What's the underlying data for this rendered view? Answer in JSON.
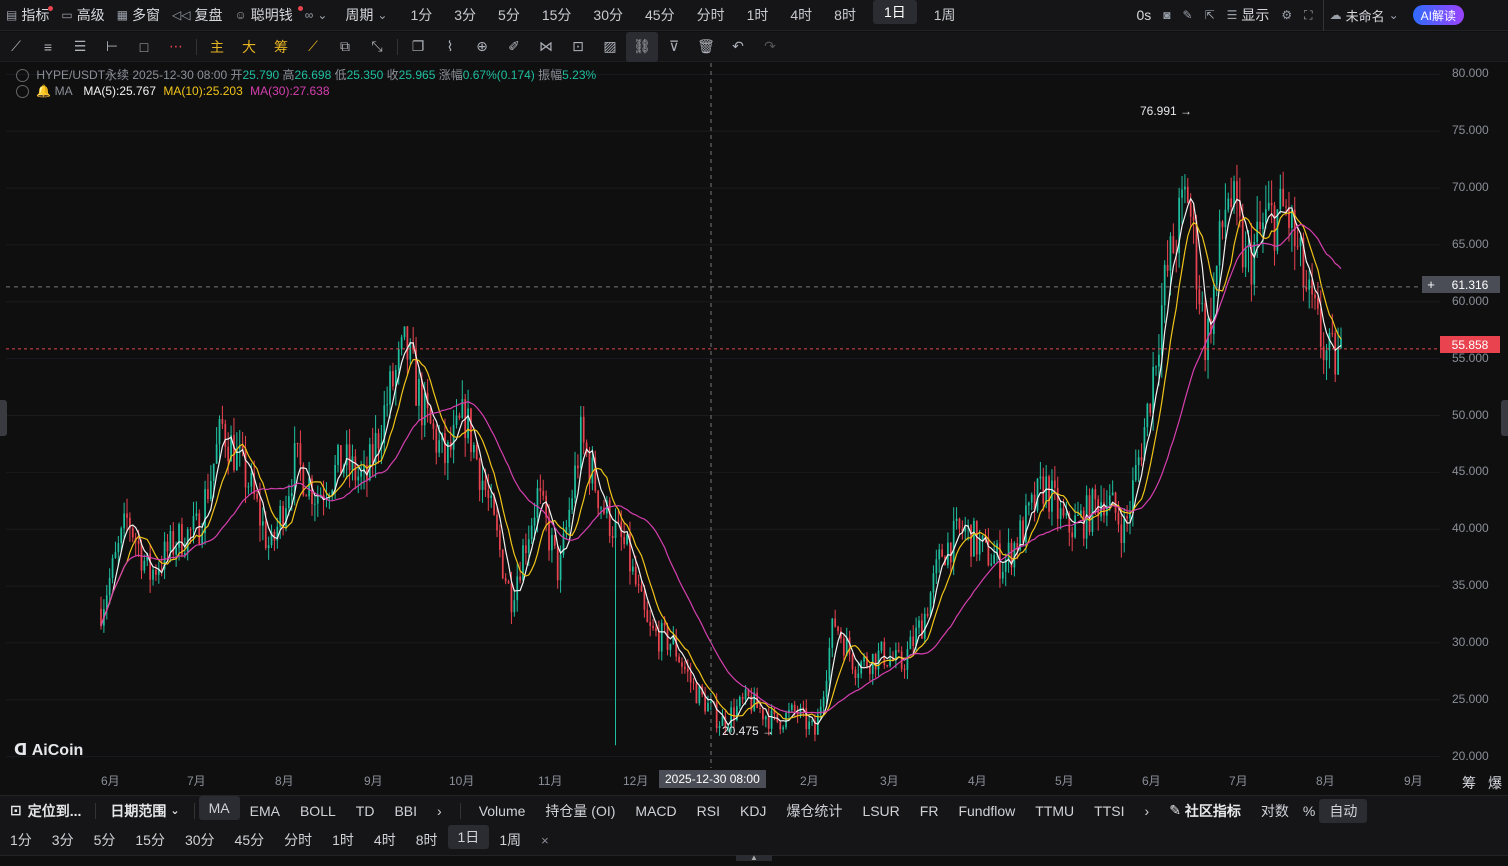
{
  "topbar": {
    "items": [
      {
        "label": "指标",
        "icon": "indicator-icon"
      },
      {
        "label": "高级",
        "icon": "layout-icon"
      },
      {
        "label": "多窗",
        "icon": "grid-icon"
      },
      {
        "label": "复盘",
        "icon": "rewind-icon"
      },
      {
        "label": "聪明钱",
        "icon": "smart-money-icon"
      }
    ],
    "period_label": "周期",
    "timeframes": [
      "1分",
      "3分",
      "5分",
      "15分",
      "30分",
      "45分",
      "分时",
      "1时",
      "4时",
      "8时",
      "1日",
      "1周"
    ],
    "active_timeframe": "1日",
    "countdown": "0s",
    "display_label": "显示",
    "unnamed_label": "未命名",
    "ai_label": "AI解读"
  },
  "legend": {
    "symbol": "HYPE/USDT永续",
    "datetime": "2025-12-30 08:00",
    "open_label": "开",
    "open": "25.790",
    "high_label": "高",
    "high": "26.698",
    "low_label": "低",
    "low": "25.350",
    "close_label": "收",
    "close": "25.965",
    "change_label": "涨幅",
    "change": "0.67%(0.174)",
    "amp_label": "振幅",
    "amp": "5.23%",
    "ma_title": "MA",
    "ma5": "MA(5):25.767",
    "ma10": "MA(10):25.203",
    "ma30": "MA(30):27.638"
  },
  "colors": {
    "up": "#1fbf9f",
    "down": "#e8434f",
    "ma5": "#f2f2f2",
    "ma10": "#f0c419",
    "ma30": "#d63fae"
  },
  "price_axis": [
    "80.000",
    "75.000",
    "70.000",
    "65.000",
    "60.000",
    "55.000",
    "50.000",
    "45.000",
    "40.000",
    "35.000",
    "30.000",
    "25.000",
    "20.000"
  ],
  "crosshair_price": "61.316",
  "current_price": "55.858",
  "high_marker": "76.991",
  "low_marker": "20.475",
  "crosshair_time": "2025-12-30 08:00",
  "watermark": "AiCoin",
  "time_axis": [
    "6月",
    "7月",
    "8月",
    "9月",
    "10月",
    "11月",
    "12月",
    "2月",
    "3月",
    "4月",
    "5月",
    "6月",
    "7月",
    "8月",
    "9月"
  ],
  "axis_corner": [
    "筹",
    "爆"
  ],
  "bottom_bar": {
    "locate": "定位到...",
    "date_range": "日期范围",
    "main_indicators": [
      "MA",
      "EMA",
      "BOLL",
      "TD",
      "BBI"
    ],
    "active_indicator": "MA",
    "sub_indicators": [
      "Volume",
      "持仓量 (OI)",
      "MACD",
      "RSI",
      "KDJ",
      "爆仓统计",
      "LSUR",
      "FR",
      "Fundflow",
      "TTMU",
      "TTSI"
    ],
    "community": "社区指标",
    "log_label": "对数",
    "pct_label": "%",
    "auto_label": "自动"
  },
  "quick_timeframes": [
    "1分",
    "3分",
    "5分",
    "15分",
    "30分",
    "45分",
    "分时",
    "1时",
    "4时",
    "8时",
    "1日",
    "1周"
  ],
  "quick_active": "1日",
  "chart_data": {
    "type": "candlestick",
    "symbol": "HYPE/USDT永续",
    "ylim": [
      19,
      81
    ],
    "x_count": 430,
    "close_path": [
      [
        0,
        33
      ],
      [
        10,
        41
      ],
      [
        18,
        36
      ],
      [
        28,
        39
      ],
      [
        36,
        40
      ],
      [
        45,
        49
      ],
      [
        55,
        44
      ],
      [
        63,
        38
      ],
      [
        72,
        46
      ],
      [
        80,
        43
      ],
      [
        90,
        46
      ],
      [
        98,
        44
      ],
      [
        107,
        52
      ],
      [
        113,
        56
      ],
      [
        120,
        50
      ],
      [
        128,
        46
      ],
      [
        135,
        50
      ],
      [
        142,
        44
      ],
      [
        152,
        34
      ],
      [
        162,
        43
      ],
      [
        170,
        36
      ],
      [
        178,
        48
      ],
      [
        186,
        42
      ],
      [
        195,
        38
      ],
      [
        203,
        31
      ],
      [
        212,
        30
      ],
      [
        220,
        26
      ],
      [
        230,
        23
      ],
      [
        240,
        25
      ],
      [
        250,
        23
      ],
      [
        258,
        24
      ],
      [
        265,
        22
      ],
      [
        272,
        32
      ],
      [
        280,
        28
      ],
      [
        290,
        29
      ],
      [
        297,
        28
      ],
      [
        305,
        32
      ],
      [
        312,
        38
      ],
      [
        320,
        40
      ],
      [
        328,
        38
      ],
      [
        335,
        37
      ],
      [
        342,
        40
      ],
      [
        350,
        44
      ],
      [
        358,
        40
      ],
      [
        365,
        41
      ],
      [
        372,
        43
      ],
      [
        380,
        40
      ],
      [
        388,
        50
      ],
      [
        395,
        62
      ],
      [
        403,
        70
      ],
      [
        410,
        56
      ],
      [
        418,
        70
      ],
      [
        425,
        63
      ],
      [
        432,
        67
      ],
      [
        440,
        68
      ],
      [
        448,
        60
      ],
      [
        455,
        55
      ],
      [
        460,
        55
      ]
    ]
  }
}
